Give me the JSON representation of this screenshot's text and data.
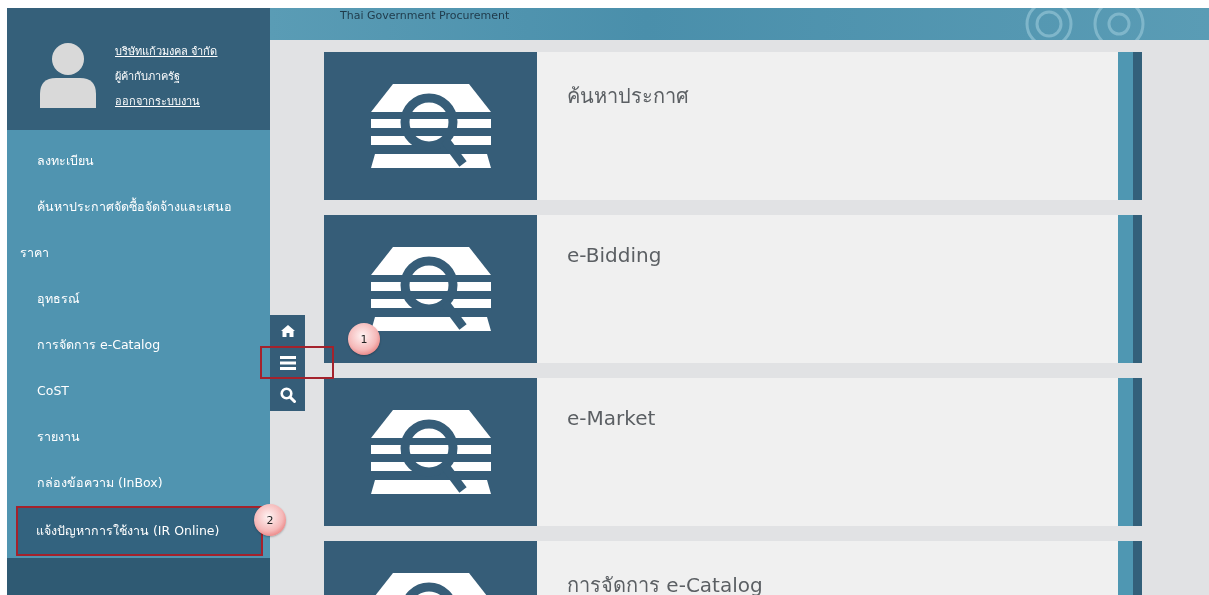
{
  "header": {
    "title": "Thai Government Procurement"
  },
  "user": {
    "company": "บริษัทแก้วมงคล จำกัด",
    "role": "ผู้ค้ากับภาครัฐ",
    "logout": "ออกจากระบบงาน"
  },
  "menu": [
    {
      "label": "ลงทะเบียน",
      "selected": false
    },
    {
      "label": "ค้นหาประกาศจัดซื้อจัดจ้างและเสนอราคา",
      "selected": false
    },
    {
      "label": "อุทธรณ์",
      "selected": false
    },
    {
      "label": "การจัดการ e-Catalog",
      "selected": false
    },
    {
      "label": "CoST",
      "selected": false
    },
    {
      "label": "รายงาน",
      "selected": false
    },
    {
      "label": "กล่องข้อความ (InBox)",
      "selected": false
    },
    {
      "label": "แจ้งปัญหาการใช้งาน (IR Online)",
      "selected": true,
      "callout": "2"
    }
  ],
  "side_buttons": [
    {
      "kind": "home"
    },
    {
      "kind": "menu",
      "callout": "1"
    },
    {
      "kind": "search"
    }
  ],
  "cards": [
    {
      "title": "ค้นหาประกาศ"
    },
    {
      "title": "e-Bidding"
    },
    {
      "title": "e-Market"
    },
    {
      "title": "การจัดการ e-Catalog"
    }
  ]
}
